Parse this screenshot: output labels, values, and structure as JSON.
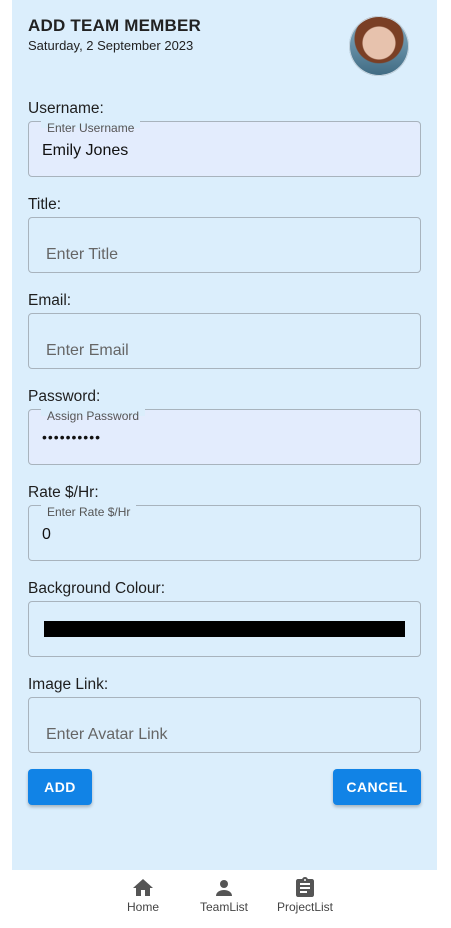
{
  "header": {
    "title": "ADD TEAM MEMBER",
    "date": "Saturday, 2 September 2023"
  },
  "form": {
    "username": {
      "label": "Username:",
      "floating_label": "Enter Username",
      "value": "Emily Jones"
    },
    "title": {
      "label": "Title:",
      "placeholder": "Enter Title"
    },
    "email": {
      "label": "Email:",
      "placeholder": "Enter Email"
    },
    "password": {
      "label": "Password:",
      "floating_label": "Assign Password",
      "value": "••••••••••"
    },
    "rate": {
      "label": "Rate $/Hr:",
      "floating_label": "Enter Rate $/Hr",
      "value": "0"
    },
    "background_colour": {
      "label": "Background Colour:",
      "value": "#000000"
    },
    "image_link": {
      "label": "Image Link:",
      "placeholder": "Enter Avatar Link"
    }
  },
  "actions": {
    "add_label": "ADD",
    "cancel_label": "CANCEL"
  },
  "bottom_nav": {
    "items": [
      {
        "label": "Home",
        "icon": "home-icon"
      },
      {
        "label": "TeamList",
        "icon": "person-icon"
      },
      {
        "label": "ProjectList",
        "icon": "clipboard-icon"
      }
    ]
  },
  "colors": {
    "panel_bg": "#dbeefc",
    "accent": "#1183e6"
  }
}
